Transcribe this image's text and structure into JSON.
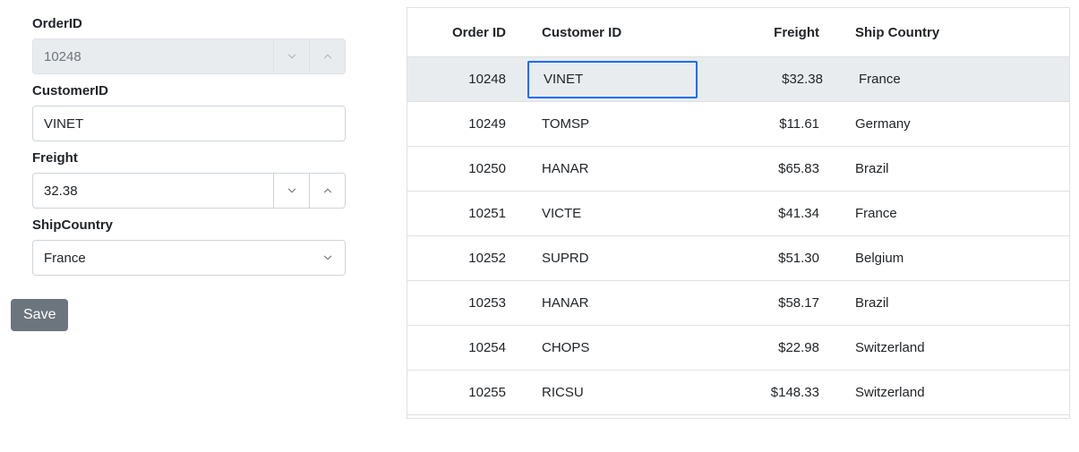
{
  "form": {
    "orderId": {
      "label": "OrderID",
      "value": "10248",
      "disabled": true
    },
    "customerId": {
      "label": "CustomerID",
      "value": "VINET"
    },
    "freight": {
      "label": "Freight",
      "value": "32.38"
    },
    "shipCountry": {
      "label": "ShipCountry",
      "value": "France"
    },
    "saveLabel": "Save"
  },
  "grid": {
    "columns": {
      "orderId": "Order ID",
      "customerId": "Customer ID",
      "freight": "Freight",
      "shipCountry": "Ship Country"
    },
    "selectedIndex": 0,
    "activeColumn": "customerId",
    "rows": [
      {
        "orderId": "10248",
        "customerId": "VINET",
        "freight": "$32.38",
        "shipCountry": "France"
      },
      {
        "orderId": "10249",
        "customerId": "TOMSP",
        "freight": "$11.61",
        "shipCountry": "Germany"
      },
      {
        "orderId": "10250",
        "customerId": "HANAR",
        "freight": "$65.83",
        "shipCountry": "Brazil"
      },
      {
        "orderId": "10251",
        "customerId": "VICTE",
        "freight": "$41.34",
        "shipCountry": "France"
      },
      {
        "orderId": "10252",
        "customerId": "SUPRD",
        "freight": "$51.30",
        "shipCountry": "Belgium"
      },
      {
        "orderId": "10253",
        "customerId": "HANAR",
        "freight": "$58.17",
        "shipCountry": "Brazil"
      },
      {
        "orderId": "10254",
        "customerId": "CHOPS",
        "freight": "$22.98",
        "shipCountry": "Switzerland"
      },
      {
        "orderId": "10255",
        "customerId": "RICSU",
        "freight": "$148.33",
        "shipCountry": "Switzerland"
      }
    ]
  }
}
